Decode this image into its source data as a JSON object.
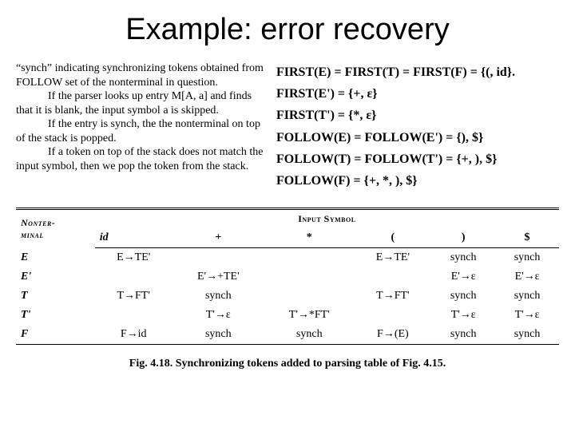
{
  "title": "Example: error recovery",
  "left": {
    "p1": "“synch” indicating synchronizing tokens obtained from FOLLOW set of the nonterminal in question.",
    "p2": "If the parser looks up entry M[A, a] and finds that it is blank, the input symbol a is skipped.",
    "p3": "If the entry is synch, the the nonterminal on top of the stack is popped.",
    "p4": "If a token on top of the stack does not match the input symbol, then we pop the token from the stack."
  },
  "first": {
    "l1": "FIRST(E) = FIRST(T) = FIRST(F) = {(, id}.",
    "l2": "FIRST(E') = {+, ε}",
    "l3": "FIRST(T') = {*, ε}",
    "l4": "FOLLOW(E) = FOLLOW(E') = {), $}",
    "l5": "FOLLOW(T) = FOLLOW(T') = {+, ), $}",
    "l6": "FOLLOW(F) = {+, *, ), $}"
  },
  "table": {
    "header_left": "Nonter-\nminal",
    "header_right": "Input Symbol",
    "cols": [
      "id",
      "+",
      "*",
      "(",
      ")",
      "$"
    ],
    "rows": [
      {
        "nt": "E",
        "cells": [
          "E→TE'",
          "",
          "",
          "E→TE'",
          "synch",
          "synch"
        ]
      },
      {
        "nt": "E'",
        "cells": [
          "",
          "E'→+TE'",
          "",
          "",
          "E'→ε",
          "E'→ε"
        ]
      },
      {
        "nt": "T",
        "cells": [
          "T→FT'",
          "synch",
          "",
          "T→FT'",
          "synch",
          "synch"
        ]
      },
      {
        "nt": "T'",
        "cells": [
          "",
          "T'→ε",
          "T'→*FT'",
          "",
          "T'→ε",
          "T'→ε"
        ]
      },
      {
        "nt": "F",
        "cells": [
          "F→id",
          "synch",
          "synch",
          "F→(E)",
          "synch",
          "synch"
        ]
      }
    ]
  },
  "caption": "Fig. 4.18.  Synchronizing tokens added to parsing table of Fig. 4.15."
}
